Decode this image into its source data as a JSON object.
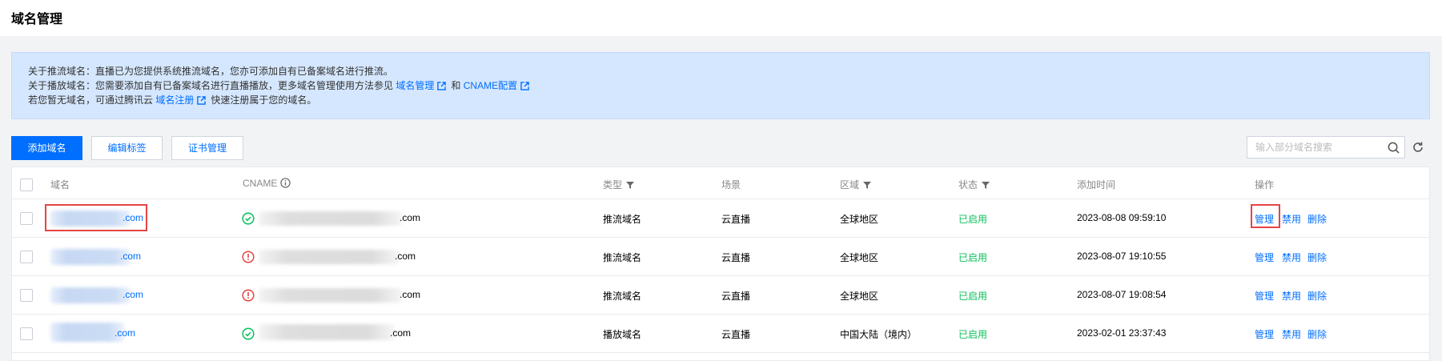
{
  "page": {
    "title": "域名管理"
  },
  "notice": {
    "line1": "关于推流域名：直播已为您提供系统推流域名，您亦可添加自有已备案域名进行推流。",
    "line2_prefix": "关于播放域名：您需要添加自有已备案域名进行直播播放，更多域名管理使用方法参见",
    "line2_link1": "域名管理",
    "line2_mid": "和",
    "line2_link2": "CNAME配置",
    "line3_prefix": "若您暂无域名，可通过腾讯云",
    "line3_link": "域名注册",
    "line3_suffix": "快速注册属于您的域名。"
  },
  "toolbar": {
    "add_domain": "添加域名",
    "edit_tags": "编辑标签",
    "cert_manage": "证书管理",
    "search_placeholder": "输入部分域名搜索"
  },
  "table": {
    "headers": {
      "domain": "域名",
      "cname": "CNAME",
      "type": "类型",
      "scene": "场景",
      "region": "区域",
      "status": "状态",
      "added": "添加时间",
      "ops": "操作"
    },
    "rows": [
      {
        "domain_suffix": ".com",
        "cname_suffix": ".com",
        "cname_ok": true,
        "type": "推流域名",
        "scene": "云直播",
        "region": "全球地区",
        "status": "已启用",
        "added": "2023-08-08 09:59:10",
        "op_manage": "管理",
        "op_disable": "禁用",
        "op_delete": "删除"
      },
      {
        "domain_suffix": ".com",
        "cname_suffix": ".com",
        "cname_ok": false,
        "type": "推流域名",
        "scene": "云直播",
        "region": "全球地区",
        "status": "已启用",
        "added": "2023-08-07 19:10:55",
        "op_manage": "管理",
        "op_disable": "禁用",
        "op_delete": "删除"
      },
      {
        "domain_suffix": ".com",
        "cname_suffix": ".com",
        "cname_ok": false,
        "type": "推流域名",
        "scene": "云直播",
        "region": "全球地区",
        "status": "已启用",
        "added": "2023-08-07 19:08:54",
        "op_manage": "管理",
        "op_disable": "禁用",
        "op_delete": "删除"
      },
      {
        "domain_suffix": ".com",
        "cname_suffix": ".com",
        "cname_ok": true,
        "type": "播放域名",
        "scene": "云直播",
        "region": "中国大陆（境内）",
        "status": "已启用",
        "added": "2023-02-01 23:37:43",
        "op_manage": "管理",
        "op_disable": "禁用",
        "op_delete": "删除"
      }
    ]
  },
  "colors": {
    "accent": "#006eff",
    "success": "#0abf5b",
    "warning": "#e54545",
    "notice_bg": "#d5e7fe"
  },
  "icons": [
    "external-link-icon",
    "filter-icon",
    "info-icon",
    "search-icon",
    "refresh-icon",
    "check-circle-icon",
    "alert-circle-icon"
  ]
}
